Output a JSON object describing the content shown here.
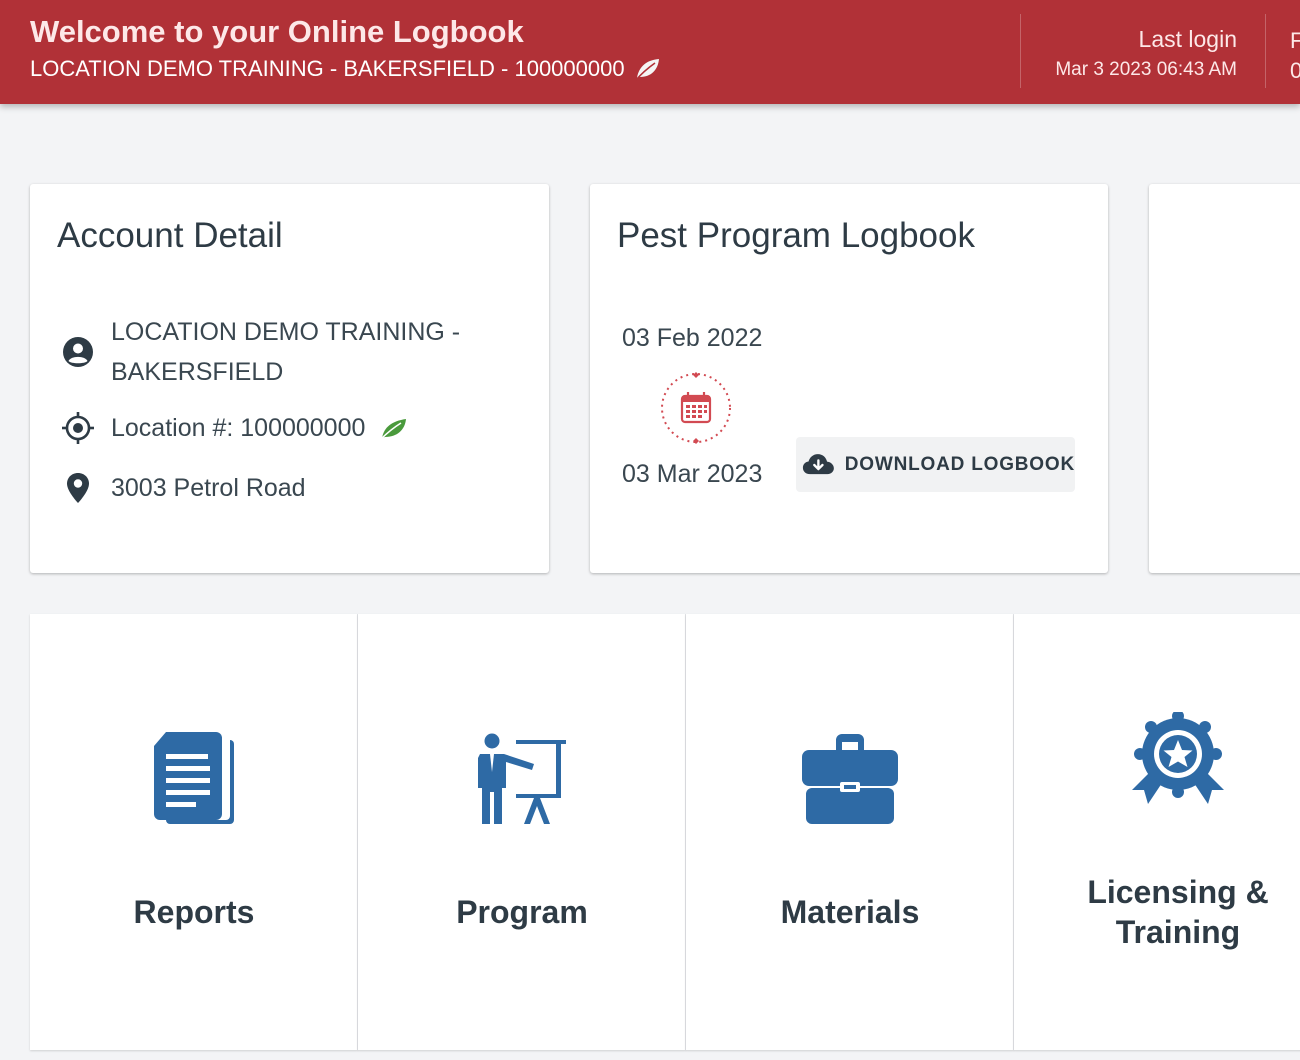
{
  "header": {
    "title": "Welcome to your Online Logbook",
    "subtitle": "LOCATION DEMO TRAINING - BAKERSFIELD - 100000000",
    "last_login_label": "Last login",
    "last_login_value": "Mar 3 2023 06:43 AM",
    "cut_text_top": "F",
    "cut_text_bottom": "0"
  },
  "account": {
    "title": "Account Detail",
    "name_line1": "LOCATION DEMO TRAINING -",
    "name_line2": "BAKERSFIELD",
    "location": "Location #: 100000000",
    "address": "3003 Petrol Road"
  },
  "logbook": {
    "title": "Pest Program Logbook",
    "date_from": "03 Feb 2022",
    "date_to": "03 Mar 2023",
    "download_label": "DOWNLOAD LOGBOOK"
  },
  "tiles": [
    {
      "label_line1": "Reports",
      "label_line2": "",
      "icon": "document-stack-icon"
    },
    {
      "label_line1": "Program",
      "label_line2": "",
      "icon": "presenter-board-icon"
    },
    {
      "label_line1": "Materials",
      "label_line2": "",
      "icon": "briefcase-icon"
    },
    {
      "label_line1": "Licensing &",
      "label_line2": "Training",
      "icon": "award-badge-icon"
    }
  ],
  "colors": {
    "brand_red": "#b13137",
    "icon_blue": "#2e6aa5",
    "leaf_green": "#4a9a3c"
  }
}
